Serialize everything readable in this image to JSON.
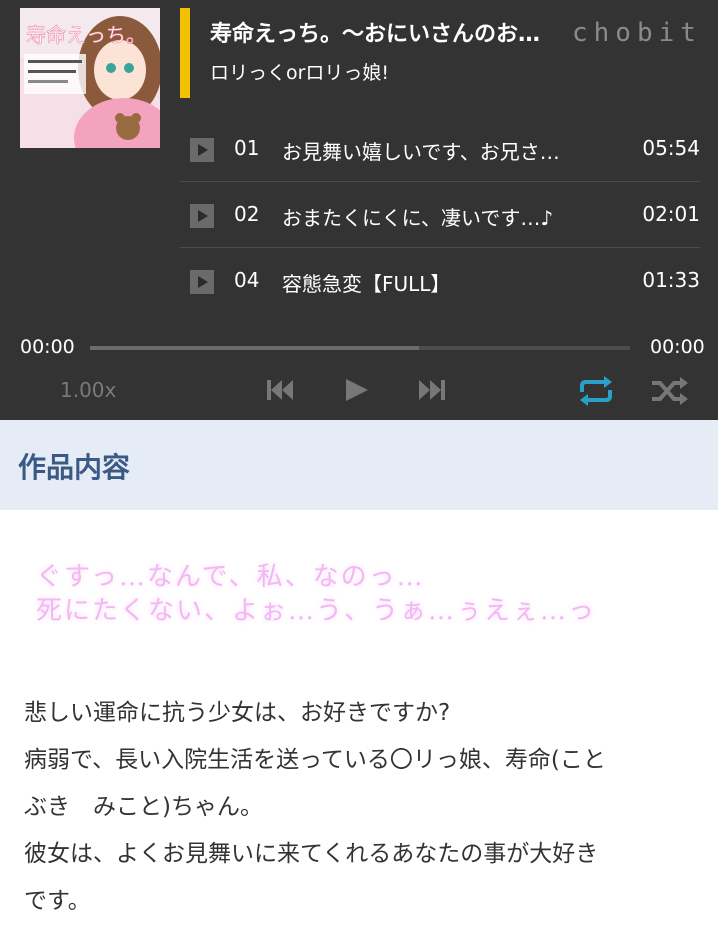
{
  "player": {
    "title": "寿命えっち。〜おにいさんのお…",
    "brand": "chobit",
    "subtitle": "ロリっくorロリっ娘!",
    "cover_text": "寿命えっち。",
    "tracks": [
      {
        "num": "01",
        "name": "お見舞い嬉しいです、お兄さ…",
        "duration": "05:54"
      },
      {
        "num": "02",
        "name": "おまたくにくに、凄いです…♪",
        "duration": "02:01"
      },
      {
        "num": "04",
        "name": "容態急変【FULL】",
        "duration": "01:33"
      }
    ],
    "time_current": "00:00",
    "time_total": "00:00",
    "progress": 0.61,
    "speed": "1.00x",
    "colors": {
      "accent": "#f2c200",
      "repeat": "#2aa0c8",
      "background": "#333333"
    }
  },
  "section": {
    "heading": "作品内容"
  },
  "quote": {
    "line1": "ぐすっ…なんで、私、なのっ…",
    "line2": "死にたくない、よぉ…う、うぁ…ぅえぇ…っ"
  },
  "description": {
    "line1": "悲しい運命に抗う少女は、お好きですか?",
    "line2": "病弱で、長い入院生活を送っている〇リっ娘、寿命(こと",
    "line3": "ぶき　みこと)ちゃん。",
    "line4": "彼女は、よくお見舞いに来てくれるあなたの事が大好き",
    "line5": "です。"
  }
}
